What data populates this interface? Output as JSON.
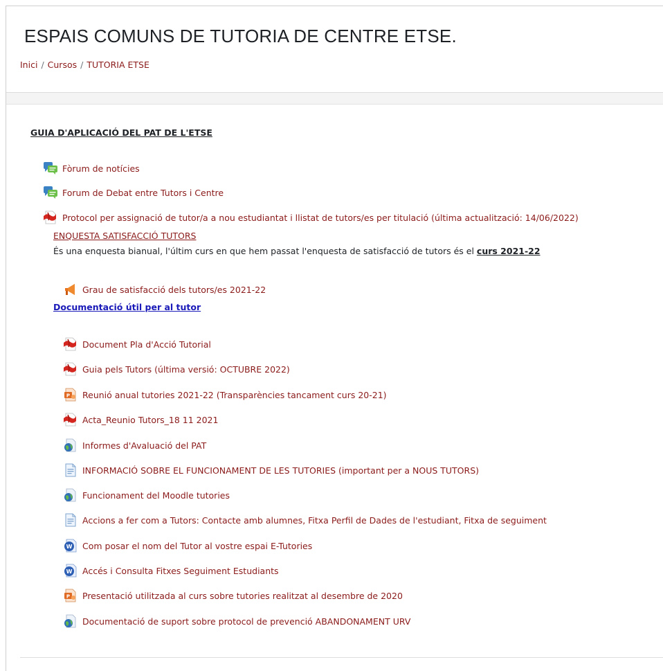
{
  "page_title": "ESPAIS COMUNS DE TUTORIA DE CENTRE ETSE.",
  "breadcrumb": [
    {
      "label": "Inici"
    },
    {
      "label": "Cursos"
    },
    {
      "label": "TUTORIA ETSE"
    }
  ],
  "breadcrumb_separator": "/",
  "section": {
    "title": "GUIA D'APLICACIÓ DEL PAT DE L'ETSE",
    "top_activities": [
      {
        "label": "Fòrum de notícies",
        "icon": "forum-icon"
      },
      {
        "label": "Forum de Debat entre Tutors i Centre",
        "icon": "forum-icon"
      },
      {
        "label": "Protocol per assignació de tutor/a a nou estudiantat i llistat de tutors/es per titulació (última actualització: 14/06/2022)",
        "icon": "pdf-icon"
      }
    ],
    "survey": {
      "title": "ENQUESTA SATISFACCIÓ TUTORS",
      "desc_prefix": "És una enquesta bianual, l'últim curs en que hem passat l'enquesta de satisfacció de tutors és el ",
      "desc_bold": "curs 2021-22",
      "feedback": {
        "label": "Grau de satisfacció dels tutors/es 2021-22",
        "icon": "megaphone-icon"
      }
    },
    "doc_link": "Documentació útil per al tutor",
    "docs": [
      {
        "label": "Document Pla d'Acció Tutorial",
        "icon": "pdf-icon"
      },
      {
        "label": "Guia pels Tutors (última versió: OCTUBRE 2022)",
        "icon": "pdf-icon"
      },
      {
        "label": "Reunió anual tutories 2021-22 (Transparències tancament curs 20-21)",
        "icon": "powerpoint-icon"
      },
      {
        "label": "Acta_Reunio Tutors_18 11 2021",
        "icon": "pdf-icon"
      },
      {
        "label": "Informes d'Avaluació del PAT",
        "icon": "url-globe-icon"
      },
      {
        "label": "INFORMACIÓ SOBRE EL FUNCIONAMENT DE LES TUTORIES (important per a NOUS TUTORS)",
        "icon": "page-icon"
      },
      {
        "label": "Funcionament del Moodle tutories",
        "icon": "url-globe-icon"
      },
      {
        "label": "Accions a fer com a Tutors: Contacte amb alumnes, Fitxa Perfil de Dades de l'estudiant, Fitxa de seguiment",
        "icon": "page-icon"
      },
      {
        "label": "Com posar el nom del Tutor al vostre espai E-Tutories",
        "icon": "word-icon"
      },
      {
        "label": "Accés i Consulta Fitxes Seguiment Estudiants",
        "icon": "word-icon"
      },
      {
        "label": "Presentació utilitzada al curs sobre tutories realitzat al desembre de 2020",
        "icon": "powerpoint-icon"
      },
      {
        "label": "Documentació de suport sobre protocol de prevenció ABANDONAMENT URV",
        "icon": "url-globe-icon"
      }
    ]
  },
  "colors": {
    "link": "#8b1a1a",
    "doc_link": "#1a1ab8",
    "text": "#1d2125"
  }
}
